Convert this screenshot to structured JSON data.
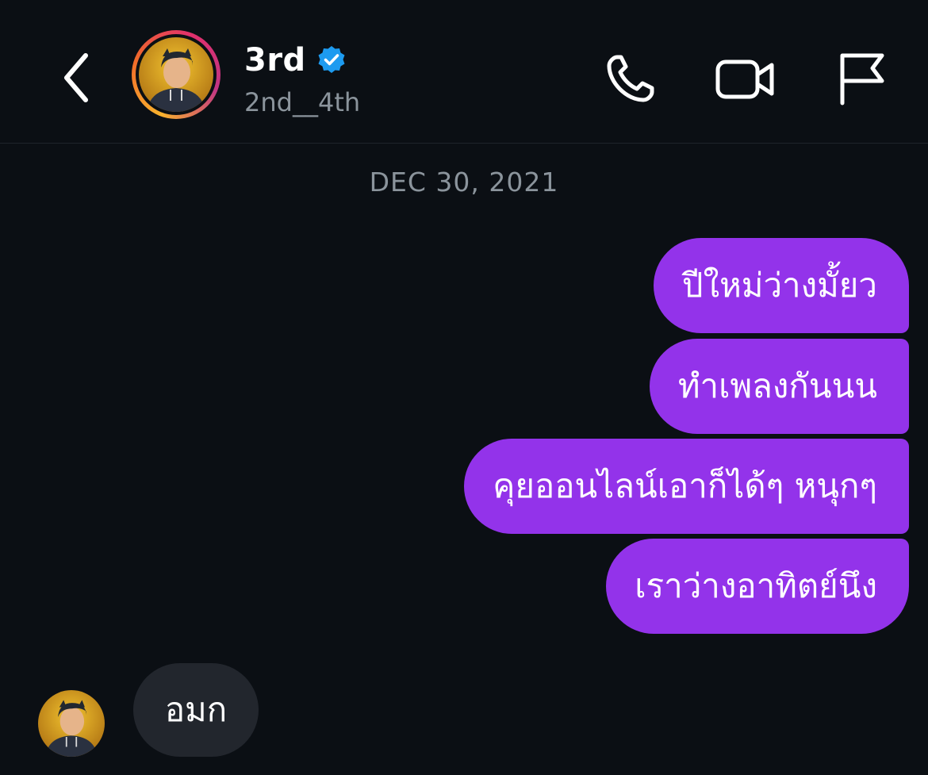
{
  "header": {
    "back_icon": "chevron-left-icon",
    "display_name": "3rd",
    "verified_icon": "verified-badge-icon",
    "username": "2nd__4th",
    "actions": [
      "phone-icon",
      "video-camera-icon",
      "flag-icon"
    ]
  },
  "conversation": {
    "date_separator": "DEC 30, 2021",
    "outgoing_messages": [
      {
        "text": "ปีใหม่ว่างมั้ยว"
      },
      {
        "text": "ทำเพลงกันนน"
      },
      {
        "text": "คุยออนไลน์เอาก็ได้ๆ หนุกๆ"
      },
      {
        "text": "เราว่างอาทิตย์นึง"
      }
    ],
    "incoming_messages": [
      {
        "text": "อมก"
      }
    ]
  },
  "colors": {
    "background": "#0b0f14",
    "outgoing_bubble": "#9333ea",
    "incoming_bubble": "#22262d",
    "muted_text": "#8b949c",
    "verified_blue": "#1d9bf0"
  }
}
